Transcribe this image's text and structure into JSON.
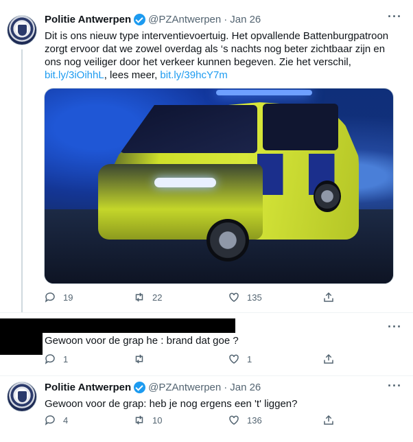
{
  "tweets": [
    {
      "author_name": "Politie Antwerpen",
      "handle": "@PZAntwerpen",
      "separator": "·",
      "date": "Jan 26",
      "text_before_links": "Dit is ons nieuw type interventievoertuig. Het opvallende Battenburgpatroon zorgt ervoor dat we zowel overdag als ‘s nachts nog beter zichtbaar zijn en ons nog veiliger door het verkeer kunnen begeven. Zie het verschil, ",
      "link1": "bit.ly/3iOihhL",
      "text_between_links": ", lees meer, ",
      "link2": "bit.ly/39hcY7m",
      "media": "van-photo",
      "replies": "19",
      "retweets": "22",
      "likes": "135"
    },
    {
      "author_name": "",
      "handle": "",
      "text": "Gewoon voor de grap he : brand dat goe ?",
      "replies": "1",
      "retweets": "",
      "likes": "1"
    },
    {
      "author_name": "Politie Antwerpen",
      "handle": "@PZAntwerpen",
      "separator": "·",
      "date": "Jan 26",
      "text": "Gewoon voor de grap: heb je nog ergens een 't' liggen?",
      "replies": "4",
      "retweets": "10",
      "likes": "136"
    }
  ],
  "more_icon": "···",
  "colors": {
    "link": "#1d9bf0",
    "verified": "#1d9bf0",
    "muted": "#536471"
  }
}
